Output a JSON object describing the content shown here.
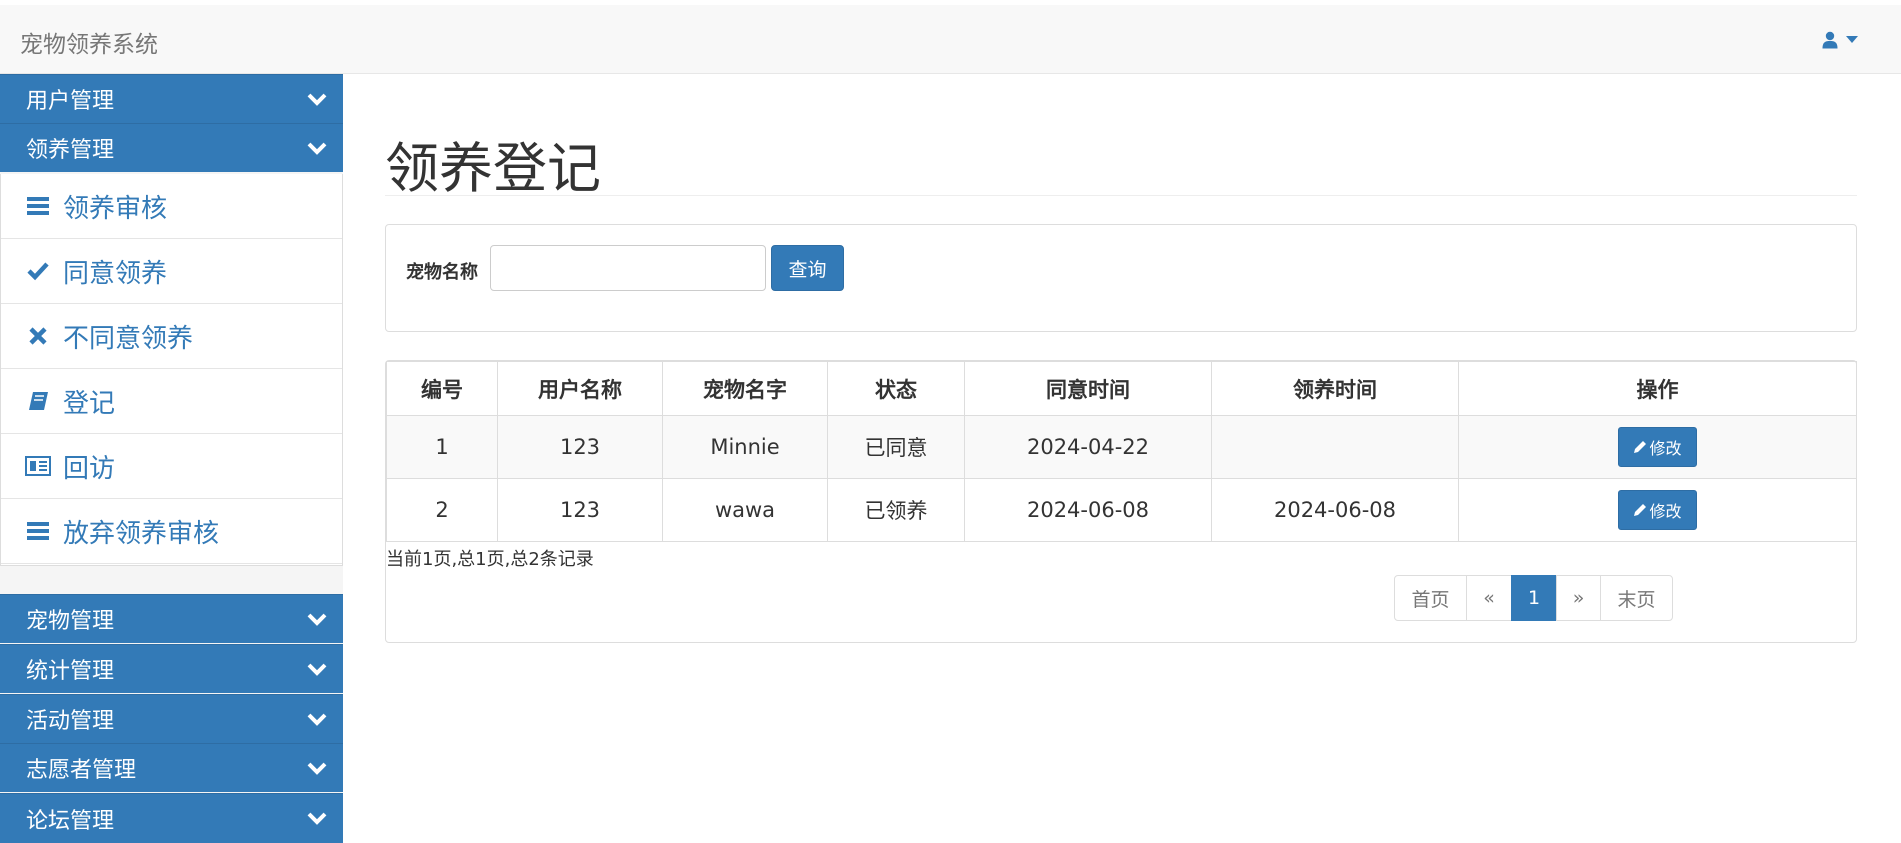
{
  "app": {
    "title": "宠物领养系统"
  },
  "sidebar": {
    "groups_top": [
      {
        "label": "用户管理",
        "icon": "chevron-down-icon"
      },
      {
        "label": "领养管理",
        "icon": "chevron-down-icon"
      }
    ],
    "sub_items": [
      {
        "label": "领养审核",
        "icon": "list-icon"
      },
      {
        "label": "同意领养",
        "icon": "check-icon"
      },
      {
        "label": "不同意领养",
        "icon": "close-icon"
      },
      {
        "label": "登记",
        "icon": "book-icon"
      },
      {
        "label": "回访",
        "icon": "newspaper-icon"
      },
      {
        "label": "放弃领养审核",
        "icon": "list-icon"
      }
    ],
    "groups_bottom": [
      {
        "label": "宠物管理",
        "icon": "chevron-down-icon"
      },
      {
        "label": "统计管理",
        "icon": "chevron-down-icon"
      },
      {
        "label": "活动管理",
        "icon": "chevron-down-icon"
      },
      {
        "label": "志愿者管理",
        "icon": "chevron-down-icon"
      },
      {
        "label": "论坛管理",
        "icon": "chevron-down-icon"
      }
    ]
  },
  "main": {
    "title": "领养登记",
    "search": {
      "label": "宠物名称",
      "value": "",
      "placeholder": "",
      "button": "查询"
    },
    "table": {
      "headers": [
        "编号",
        "用户名称",
        "宠物名字",
        "状态",
        "同意时间",
        "领养时间",
        "操作"
      ],
      "rows": [
        {
          "id": "1",
          "user": "123",
          "pet": "Minnie",
          "status": "已同意",
          "agree_time": "2024-04-22",
          "adopt_time": "",
          "action": "修改"
        },
        {
          "id": "2",
          "user": "123",
          "pet": "wawa",
          "status": "已领养",
          "agree_time": "2024-06-08",
          "adopt_time": "2024-06-08",
          "action": "修改"
        }
      ]
    },
    "page_info": "当前1页,总1页,总2条记录",
    "pagination": {
      "first": "首页",
      "prev": "«",
      "current": "1",
      "next": "»",
      "last": "末页"
    }
  },
  "colors": {
    "primary": "#337ab7",
    "navbar": "#f8f8f8",
    "border": "#dddddd"
  }
}
